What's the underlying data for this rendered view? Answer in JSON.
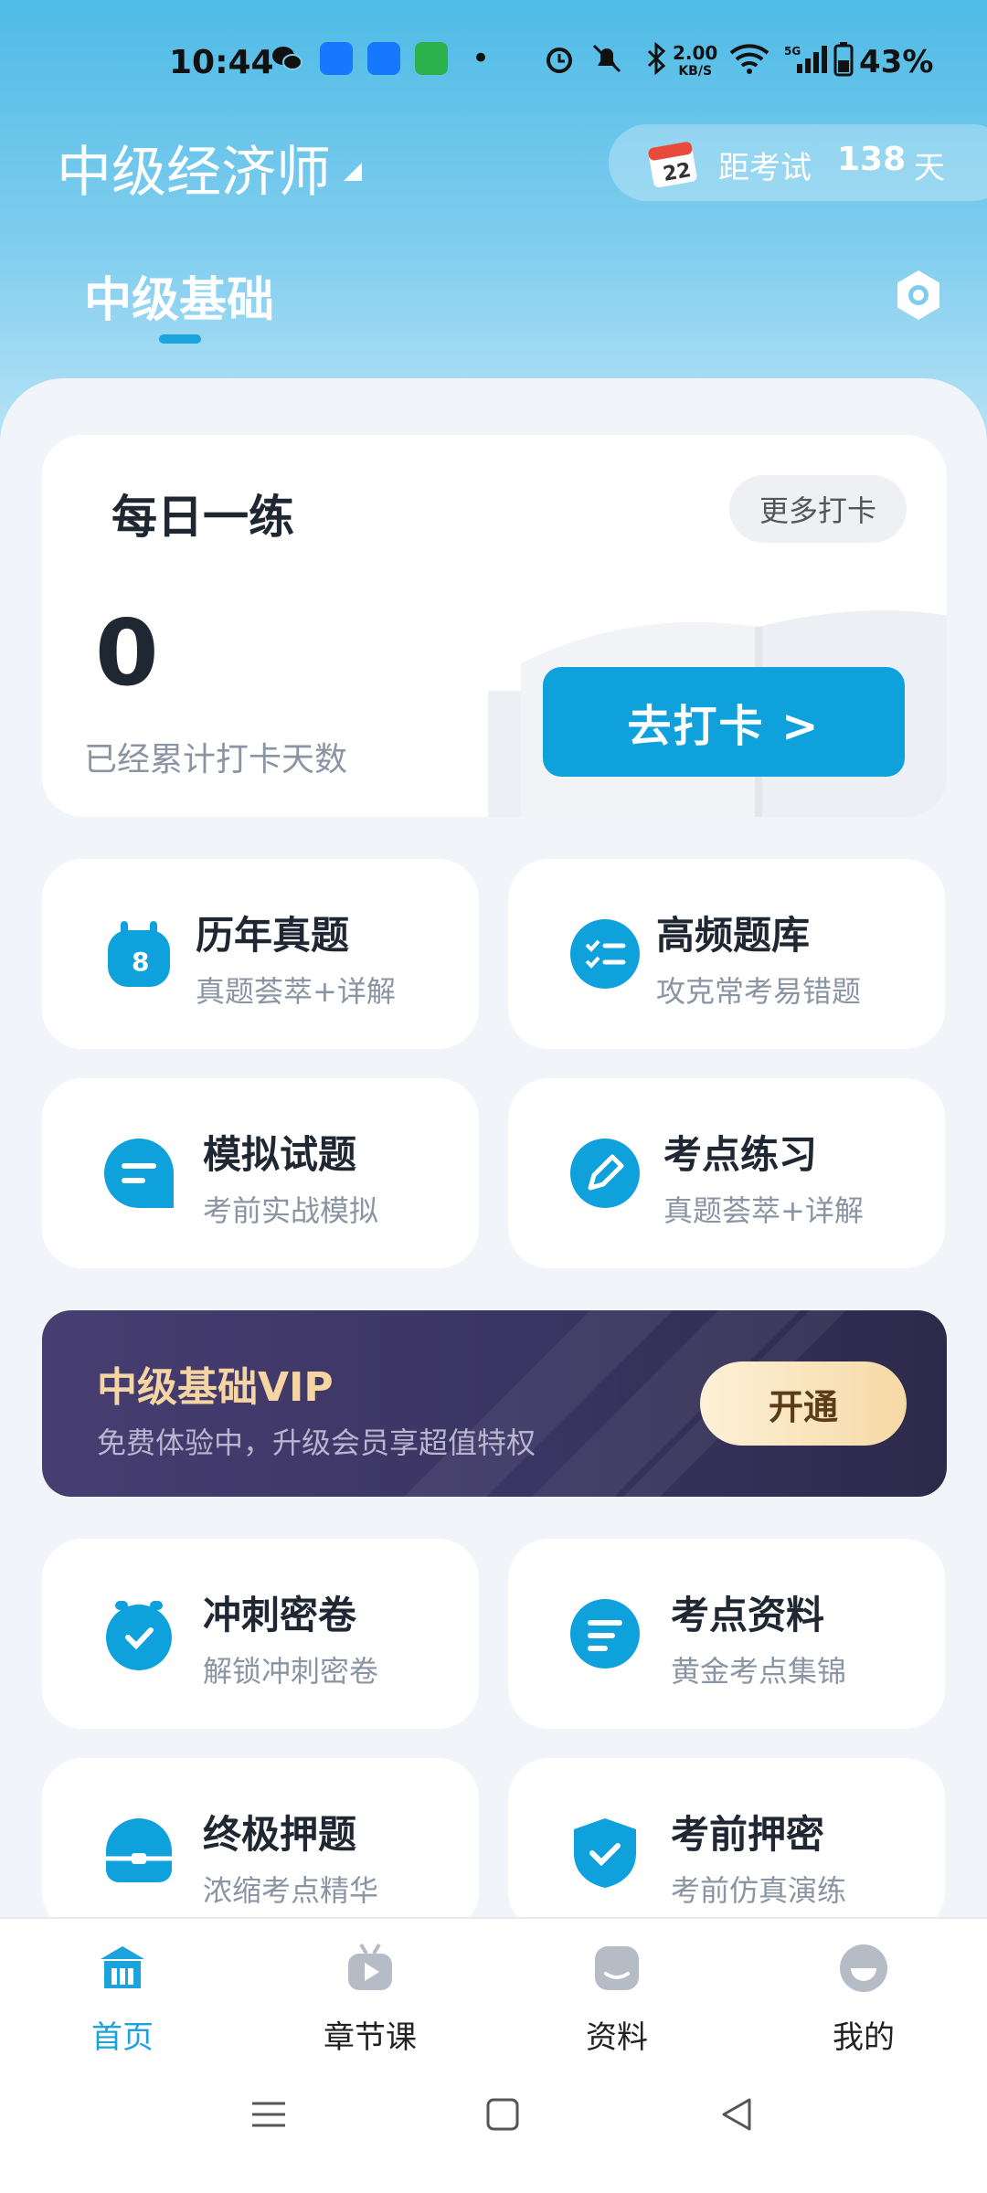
{
  "status_bar": {
    "time": "10:44",
    "net_rate": "2.00",
    "net_unit": "KB/S",
    "battery": "43%"
  },
  "header": {
    "exam_title": "中级经济师",
    "countdown_label": "距考试",
    "countdown_days": "138",
    "countdown_unit": "天",
    "calendar_day": "22"
  },
  "tabs": {
    "active": "中级基础"
  },
  "daily": {
    "title": "每日一练",
    "more_label": "更多打卡",
    "count": "0",
    "count_label": "已经累计打卡天数",
    "go_label": "去打卡 >"
  },
  "features": [
    {
      "title": "历年真题",
      "subtitle": "真题荟萃+详解",
      "icon": "calendar-icon"
    },
    {
      "title": "高频题库",
      "subtitle": "攻克常考易错题",
      "icon": "checklist-icon"
    },
    {
      "title": "模拟试题",
      "subtitle": "考前实战模拟",
      "icon": "chat-bubble-icon"
    },
    {
      "title": "考点练习",
      "subtitle": "真题荟萃+详解",
      "icon": "pencil-icon"
    },
    {
      "title": "冲刺密卷",
      "subtitle": "解锁冲刺密卷",
      "icon": "alarm-check-icon"
    },
    {
      "title": "考点资料",
      "subtitle": "黄金考点集锦",
      "icon": "document-lines-icon"
    },
    {
      "title": "终极押题",
      "subtitle": "浓缩考点精华",
      "icon": "briefcase-icon"
    },
    {
      "title": "考前押密",
      "subtitle": "考前仿真演练",
      "icon": "shield-check-icon"
    }
  ],
  "vip": {
    "title": "中级基础VIP",
    "subtitle": "免费体验中，升级会员享超值特权",
    "button": "开通"
  },
  "bottom_nav": [
    {
      "label": "首页",
      "icon": "home-icon",
      "active": true
    },
    {
      "label": "章节课",
      "icon": "tv-play-icon",
      "active": false
    },
    {
      "label": "资料",
      "icon": "material-icon",
      "active": false
    },
    {
      "label": "我的",
      "icon": "profile-icon",
      "active": false
    }
  ],
  "colors": {
    "accent": "#0ea1dc",
    "vip_gold": "#f5d6a3",
    "vip_bg": "#3a3462"
  }
}
